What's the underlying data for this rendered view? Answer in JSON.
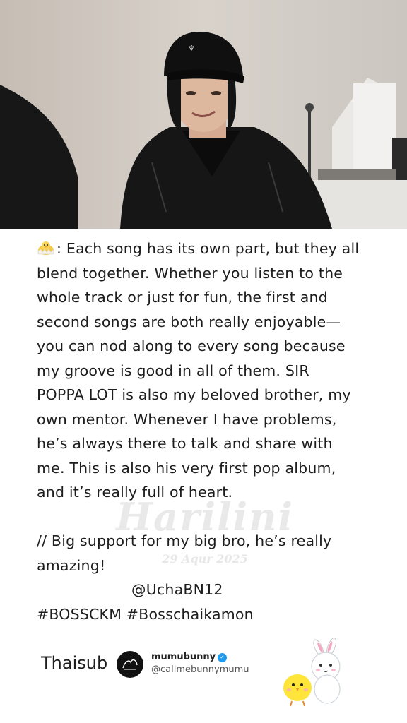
{
  "caption": {
    "lines": [
      ": Each song has its own part, but they all",
      "blend together. Whether you listen to the",
      "whole track or just for fun, the first and",
      "second songs are both really enjoyable—",
      "you can nod along to every song because",
      "my groove is good in all of them. SIR",
      "POPPA LOT is also my beloved brother, my",
      "own mentor. Whenever I have problems,",
      "he’s always there to talk and share with",
      "me. This is also his very first pop album,",
      "and it’s really full of heart."
    ],
    "support_lines": [
      "// Big support for my big bro, he’s really",
      "amazing!"
    ],
    "mention": "@UchaBN12",
    "hashtags": "#BOSSCKM #Bosschaikamon"
  },
  "watermark": {
    "name": "Harilini",
    "date": "29 Aqur 2025"
  },
  "footer": {
    "label": "Thaisub",
    "account_name": "mumubunny",
    "account_handle": "@callmebunnymumu"
  },
  "icons": {
    "speaker": "chick-emoji-icon",
    "verified": "verified-badge-icon",
    "mascot": "chick-and-bunny-sticker"
  }
}
